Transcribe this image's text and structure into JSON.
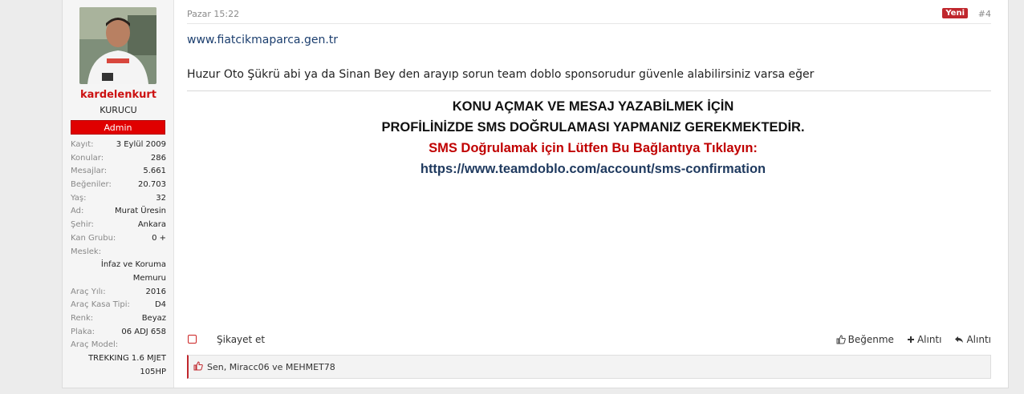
{
  "user": {
    "name": "kardelenkurt",
    "title": "KURUCU",
    "badge": "Admin",
    "stats": [
      {
        "label": "Kayıt:",
        "value": "3 Eylül 2009"
      },
      {
        "label": "Konular:",
        "value": "286"
      },
      {
        "label": "Mesajlar:",
        "value": "5.661"
      },
      {
        "label": "Beğeniler:",
        "value": "20.703"
      },
      {
        "label": "Yaş:",
        "value": "32"
      },
      {
        "label": "Ad:",
        "value": "Murat Üresin"
      },
      {
        "label": "Şehir:",
        "value": "Ankara"
      },
      {
        "label": "Kan Grubu:",
        "value": "0 +"
      }
    ],
    "meslek_label": "Meslek:",
    "meslek_line1": "İnfaz ve Koruma",
    "meslek_line2": "Memuru",
    "stats2": [
      {
        "label": "Araç Yılı:",
        "value": "2016"
      },
      {
        "label": "Araç Kasa Tipi:",
        "value": "D4"
      },
      {
        "label": "Renk:",
        "value": "Beyaz"
      },
      {
        "label": "Plaka:",
        "value": "06 ADJ 658"
      }
    ],
    "model_label": "Araç Model:",
    "model_line1": "TREKKING 1.6 MJET",
    "model_line2": "105HP"
  },
  "post": {
    "time": "Pazar 15:22",
    "new_tag": "Yeni",
    "number": "#4",
    "link": "www.fiatcikmaparca.gen.tr",
    "message": "Huzur Oto Şükrü abi ya da Sinan Bey den arayıp sorun team doblo sponsorudur güvenle alabilirsiniz varsa eğer"
  },
  "notice": {
    "line1": "KONU AÇMAK VE MESAJ YAZABİLMEK İÇİN",
    "line2": "PROFİLİNİZDE SMS DOĞRULAMASI YAPMANIZ GEREKMEKTEDİR.",
    "line3": "SMS Doğrulamak için Lütfen Bu Bağlantıya Tıklayın:",
    "line4": "https://www.teamdoblo.com/account/sms-confirmation"
  },
  "actions": {
    "report": "Şikayet et",
    "like": "Beğenme",
    "quote": "Alıntı",
    "reply": "Alıntı"
  },
  "likes": {
    "text": "Sen, Miracc06 ve MEHMET78"
  },
  "colors": {
    "accent": "#c0272d",
    "admin_badge": "#e00000",
    "link": "#1b3e6e"
  }
}
